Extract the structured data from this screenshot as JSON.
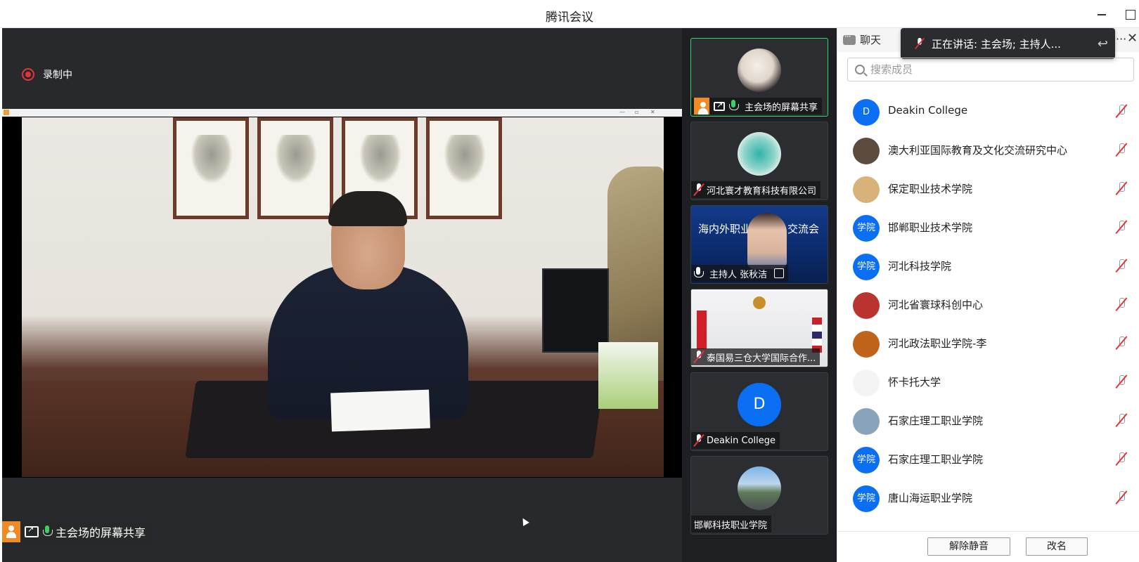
{
  "window": {
    "title": "腾讯会议"
  },
  "stage": {
    "recording_label": "录制中",
    "presenter_label": "主会场的屏幕共享"
  },
  "tiles": [
    {
      "name": "主会场的屏幕共享",
      "type": "avatar",
      "active": true
    },
    {
      "name": "河北寰才教育科技有限公司",
      "type": "avatar",
      "muted": true
    },
    {
      "name": "主持人 张秋洁",
      "type": "video-host",
      "banner": "海内外职业",
      "banner_tail": "交流会"
    },
    {
      "name": "泰国易三仓大学国际合作...",
      "type": "video-thai",
      "muted": true
    },
    {
      "name": "Deakin College",
      "type": "initial",
      "initial": "D",
      "muted": true
    },
    {
      "name": "邯郸科技职业学院",
      "type": "avatar"
    }
  ],
  "panel": {
    "chat_tab": "聊天",
    "speaking_toast": "正在讲话: 主会场; 主持人...",
    "more_label": "···",
    "close_label": "✕",
    "search_placeholder": "搜索成员",
    "members": [
      {
        "name": "Deakin College",
        "avatar_text": "D",
        "avatar_color": "#0b6ff3"
      },
      {
        "name": "澳大利亚国际教育及文化交流研究中心",
        "avatar_text": "",
        "avatar_color": "#5a4b3e"
      },
      {
        "name": "保定职业技术学院",
        "avatar_text": "",
        "avatar_color": "#d9b27a"
      },
      {
        "name": "邯郸职业技术学院",
        "avatar_text": "学院",
        "avatar_color": "#0b6ff3"
      },
      {
        "name": "河北科技学院",
        "avatar_text": "学院",
        "avatar_color": "#0b6ff3"
      },
      {
        "name": "河北省寰球科创中心",
        "avatar_text": "",
        "avatar_color": "#b9342f"
      },
      {
        "name": "河北政法职业学院-李",
        "avatar_text": "",
        "avatar_color": "#c0641c"
      },
      {
        "name": "怀卡托大学",
        "avatar_text": "",
        "avatar_color": "#f4f4f4"
      },
      {
        "name": "石家庄理工职业学院",
        "avatar_text": "",
        "avatar_color": "#8aa3bd"
      },
      {
        "name": "石家庄理工职业学院",
        "avatar_text": "学院",
        "avatar_color": "#0b6ff3"
      },
      {
        "name": "唐山海运职业学院",
        "avatar_text": "学院",
        "avatar_color": "#0b6ff3"
      }
    ],
    "unmute_button": "解除静音",
    "rename_button": "改名"
  }
}
